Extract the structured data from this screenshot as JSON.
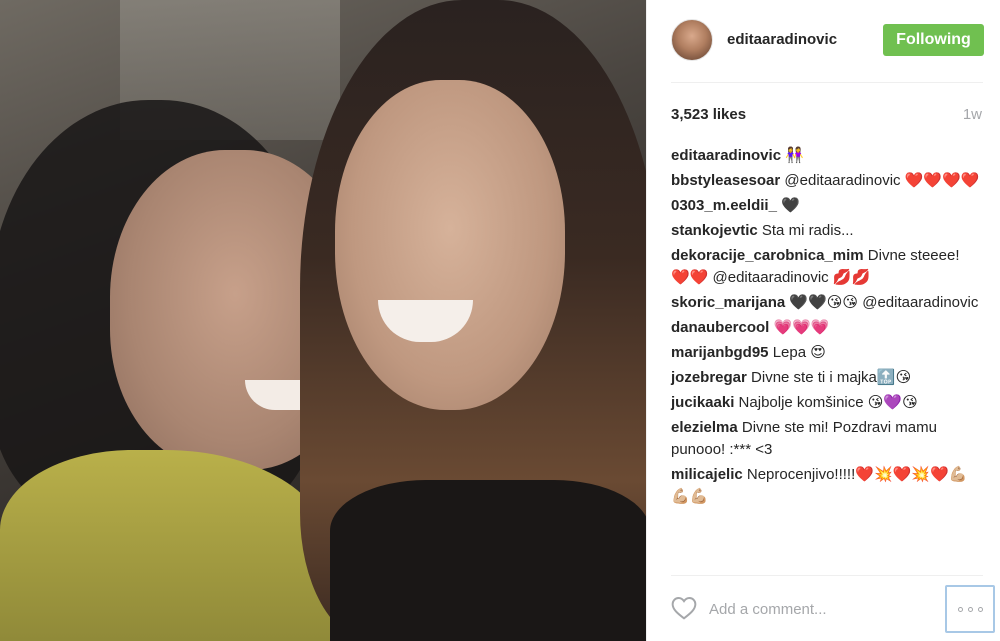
{
  "post": {
    "username": "editaaradinovic",
    "follow_label": "Following",
    "likes": "3,523 likes",
    "time": "1w",
    "icons": {
      "like": "heart-outline-icon",
      "more": "more-options-icon"
    },
    "colors": {
      "follow_bg": "#70c050",
      "username": "#262626",
      "muted": "#a5a7aa",
      "link": "#003569"
    }
  },
  "comments": [
    {
      "user": "editaaradinovic",
      "text": " 👭"
    },
    {
      "user": "bbstyleasesoar",
      "text": " @editaaradinovic ❤️❤️❤️❤️"
    },
    {
      "user": "0303_m.eeldii_",
      "text": " 🖤"
    },
    {
      "user": "stankojevtic",
      "text": " Sta mi radis..."
    },
    {
      "user": "dekoracije_carobnica_mim",
      "text": " Divne steeee! ❤️❤️ @editaaradinovic 💋💋"
    },
    {
      "user": "skoric_marijana",
      "text": " 🖤🖤😘😘 @editaaradinovic"
    },
    {
      "user": "danaubercool",
      "text": " 💗💗💗"
    },
    {
      "user": "marijanbgd95",
      "text": " Lepa 😍"
    },
    {
      "user": "jozebregar",
      "text": " Divne ste ti i majka🔝😘"
    },
    {
      "user": "jucikaaki",
      "text": " Najbolje komšinice 😘💜😘"
    },
    {
      "user": "elezielma",
      "text": " Divne ste mi! Pozdravi mamu punooo! :*** <3"
    },
    {
      "user": "milicajelic",
      "text": " Neprocenjivo!!!!!❤️💥❤️💥❤️💪🏼💪🏼💪🏼"
    }
  ],
  "comment_box": {
    "placeholder": "Add a comment..."
  }
}
